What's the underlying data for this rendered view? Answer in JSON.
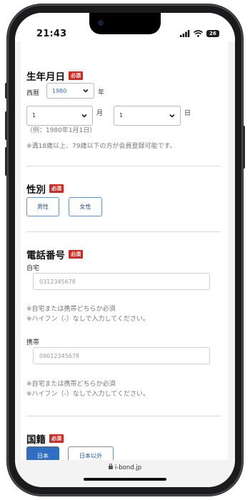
{
  "status": {
    "time": "21:43",
    "battery": "26"
  },
  "birth": {
    "title": "生年月日",
    "required": "必須",
    "era_label": "西暦",
    "year_value": "1980",
    "year_unit": "年",
    "month_value": "1",
    "month_unit": "月",
    "day_value": "1",
    "day_unit": "日",
    "example": "（例：1980年1月1日）",
    "note": "※満18歳以上、79歳以下の方が会員登録可能です。"
  },
  "gender": {
    "title": "性別",
    "required": "必須",
    "male": "男性",
    "female": "女性"
  },
  "phone": {
    "title": "電話番号",
    "required": "必須",
    "home_label": "自宅",
    "home_placeholder": "0312345678",
    "home_note1": "※自宅または携帯どちらか必須",
    "home_note2": "※ハイフン（-）なしで入力してください。",
    "mobile_label": "携帯",
    "mobile_placeholder": "09012345678",
    "mobile_note1": "※自宅または携帯どちらか必須",
    "mobile_note2": "※ハイフン（-）なしで入力してください。"
  },
  "nationality": {
    "title": "国籍",
    "required": "必須",
    "japan": "日本",
    "other": "日本以外"
  },
  "browser": {
    "url": "i-bond.jp"
  },
  "colors": {
    "required_badge": "#d7281f",
    "accent": "#2f6ec1"
  }
}
